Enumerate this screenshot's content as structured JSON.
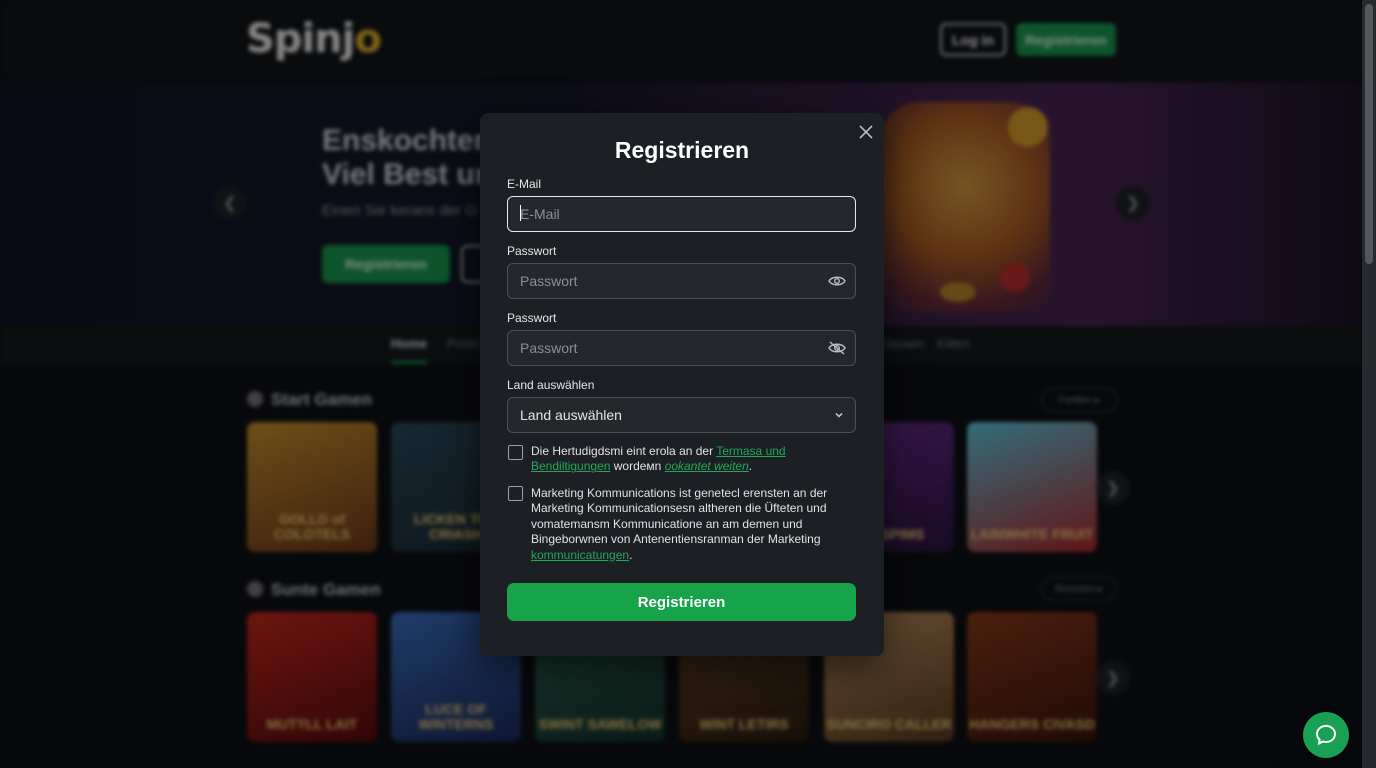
{
  "header": {
    "logo_main": "Spinj",
    "logo_accent": "o",
    "login_label": "Log in",
    "register_label": "Registrieren"
  },
  "hero": {
    "title_line1": "Enskochten u",
    "title_line2": "Viel Best und",
    "subtitle": "Einen Sie kerans der G",
    "register_label": "Registrieren"
  },
  "nav": {
    "items": [
      "Home",
      "Posto",
      "Klassen",
      "Kilten"
    ]
  },
  "sections": [
    {
      "title": "Start Gamen",
      "pill": "Funtten ▸"
    },
    {
      "title": "Sunte Gamen",
      "pill": "Renniten ▸"
    }
  ],
  "games_row1": [
    "GOLLD of COLOTELS",
    "LICKEN THE CRIASH",
    "500 SPIMS",
    "LAINWHITE FRUIT"
  ],
  "games_row2": [
    "MUTTLL LAIT",
    "LUCE OF WINTERNS",
    "SWINT SAWELOW",
    "WINT LETIRS",
    "SUNCIRO CALLER",
    "HANGERS CIVASD"
  ],
  "modal": {
    "title": "Registrieren",
    "email_label": "E-Mail",
    "email_placeholder": "E-Mail",
    "password_label": "Passwort",
    "password_placeholder": "Passwort",
    "password2_label": "Passwort",
    "password2_placeholder": "Passwort",
    "country_label": "Land auswählen",
    "country_value": "Land auswählen",
    "terms_text_1": "Die Hertudigdsmi eint erola an der ",
    "terms_link_1": "Termasa und Bendiltigungen",
    "terms_text_2": " wordeмn ",
    "terms_link_2": "ookantet weiten",
    "terms_text_3": ".",
    "marketing_text": "Marketing Kommunications ist genetecl erensten an der Marketing Kommunicationsesn altheren die Üfteten und vomatemansm Kommunicatione an am demen und Bingeborwnen von Antenentiensranmаn der Marketing ",
    "marketing_link": "kommunicatungen",
    "marketing_end": ".",
    "submit_label": "Registrieren"
  },
  "icons": {
    "close": "close-icon",
    "eye": "eye-icon",
    "eye_off": "eye-off-icon",
    "chevron": "chevron-down-icon",
    "chat": "chat-icon"
  },
  "colors": {
    "accent": "#16a34a",
    "modal_bg": "#1c1f23",
    "link": "#23a85a"
  }
}
